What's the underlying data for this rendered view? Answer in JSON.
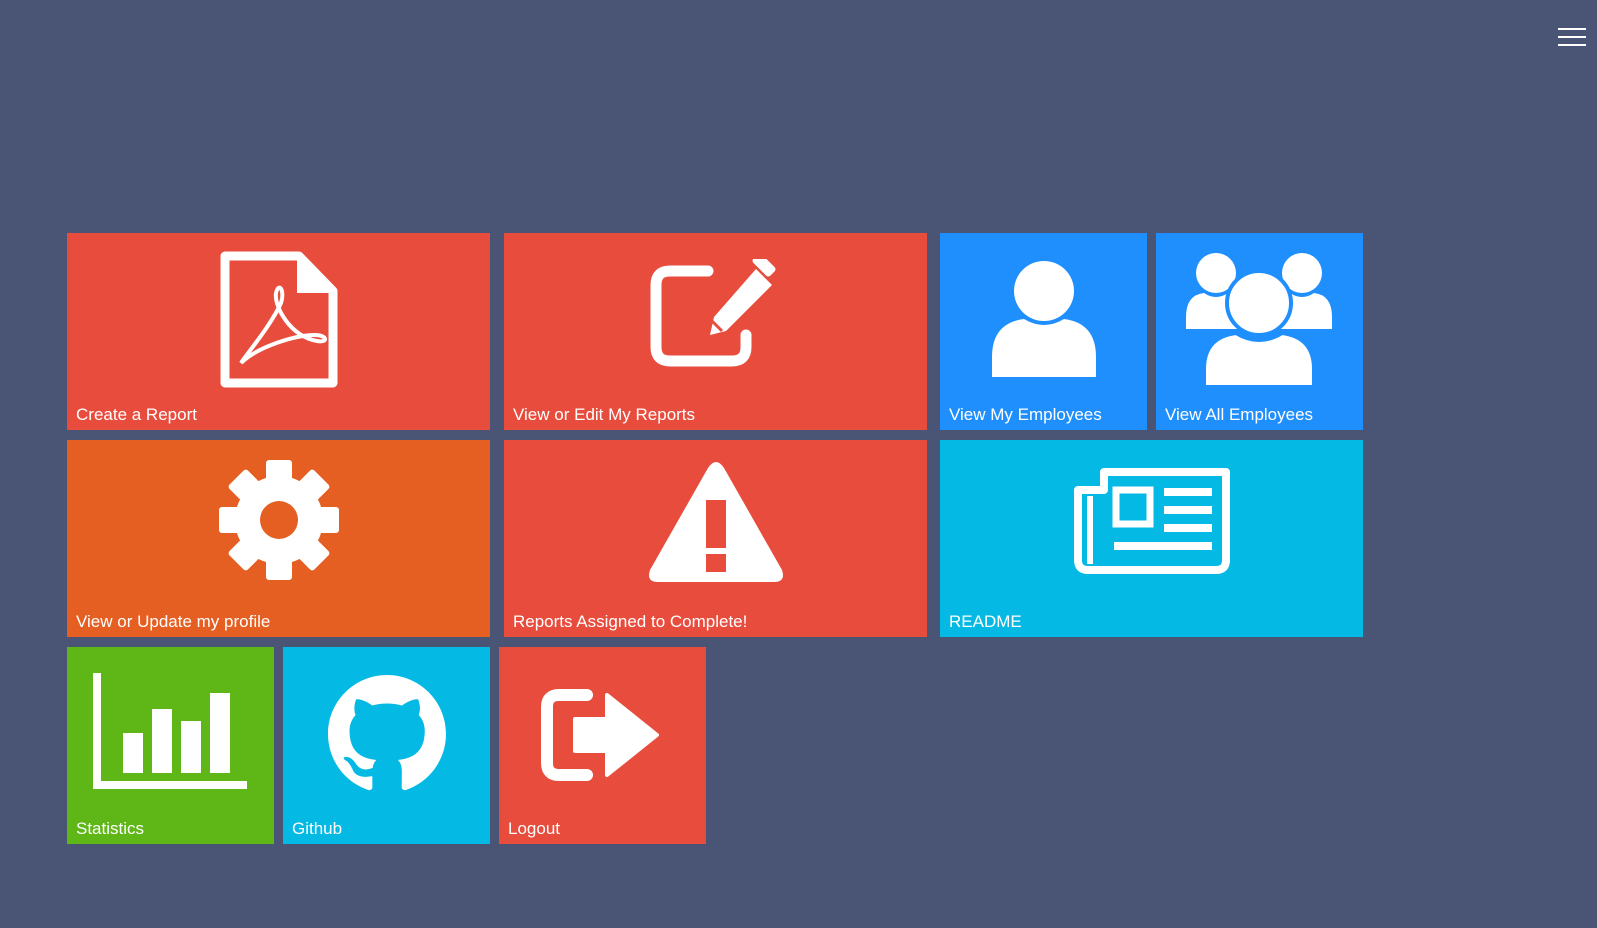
{
  "colors": {
    "background": "#4a5474",
    "red": "#e84c3d",
    "orange": "#e65f22",
    "blue": "#1f8ffe",
    "cyan": "#04b9e4",
    "green": "#5fb617"
  },
  "header": {
    "menu_icon": "hamburger-menu-icon"
  },
  "tiles": [
    {
      "label": "Create a Report",
      "icon": "pdf-file-icon",
      "color": "#e84c3d"
    },
    {
      "label": "View or Edit My Reports",
      "icon": "edit-icon",
      "color": "#e84c3d"
    },
    {
      "label": "View My Employees",
      "icon": "user-icon",
      "color": "#1f8ffe"
    },
    {
      "label": "View All Employees",
      "icon": "users-icon",
      "color": "#1f8ffe"
    },
    {
      "label": "View or Update my profile",
      "icon": "gear-icon",
      "color": "#e65f22"
    },
    {
      "label": "Reports Assigned to Complete!",
      "icon": "warning-icon",
      "color": "#e84c3d"
    },
    {
      "label": "README",
      "icon": "newspaper-icon",
      "color": "#04b9e4"
    },
    {
      "label": "Statistics",
      "icon": "bar-chart-icon",
      "color": "#5fb617"
    },
    {
      "label": "Github",
      "icon": "github-icon",
      "color": "#04b9e4"
    },
    {
      "label": "Logout",
      "icon": "logout-icon",
      "color": "#e84c3d"
    }
  ]
}
